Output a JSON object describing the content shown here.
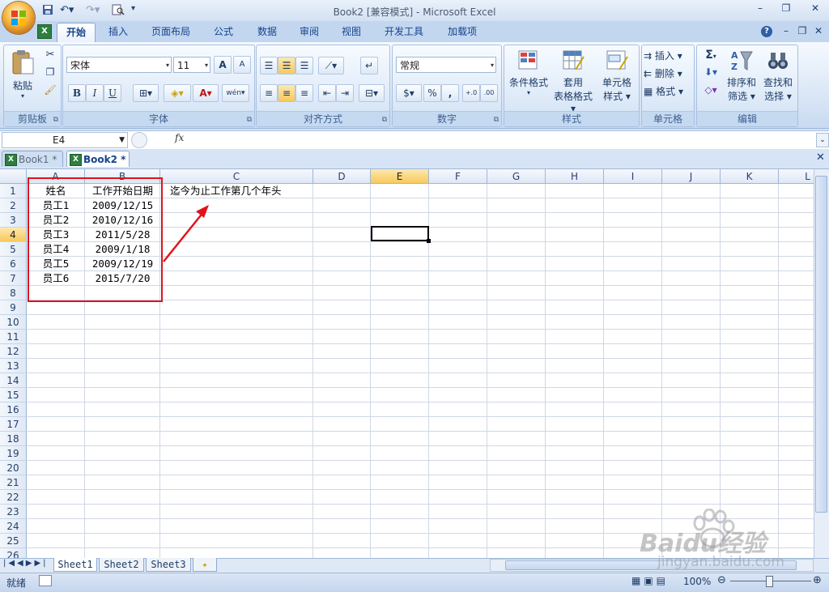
{
  "window": {
    "title": "Book2  [兼容模式] - Microsoft Excel",
    "controls": [
      "–",
      "❐",
      "✕"
    ],
    "doc_controls": [
      "?",
      "–",
      "❐",
      "✕"
    ]
  },
  "ribbon": {
    "tabs": [
      "开始",
      "插入",
      "页面布局",
      "公式",
      "数据",
      "审阅",
      "视图",
      "开发工具",
      "加载项"
    ],
    "active_tab": "开始",
    "clipboard": {
      "paste_label": "粘贴",
      "group_label": "剪贴板"
    },
    "font": {
      "name": "宋体",
      "size": "11",
      "group_label": "字体",
      "bold": "B",
      "italic": "I",
      "underline": "U",
      "grow": "A",
      "shrink": "A",
      "phonetic": "wén"
    },
    "alignment": {
      "group_label": "对齐方式"
    },
    "number": {
      "format": "常规",
      "group_label": "数字",
      "percent": "%",
      "comma": ",",
      "inc_decimal": "+.0",
      "dec_decimal": ".00"
    },
    "styles": {
      "group_label": "样式",
      "conditional": "条件格式",
      "table_format": [
        "套用",
        "表格格式"
      ],
      "cell_styles": [
        "单元格",
        "样式"
      ]
    },
    "cells": {
      "group_label": "单元格",
      "insert": "插入",
      "delete": "删除",
      "format": "格式"
    },
    "editing": {
      "group_label": "编辑",
      "sum": "Σ",
      "sort_filter": [
        "排序和",
        "筛选"
      ],
      "find_select": [
        "查找和",
        "选择"
      ]
    }
  },
  "formula_bar": {
    "name_box": "E4",
    "fx": "fx",
    "content": ""
  },
  "workbooks": [
    {
      "label": "Book1 *",
      "active": false
    },
    {
      "label": "Book2 *",
      "active": true
    }
  ],
  "grid": {
    "columns": [
      "A",
      "B",
      "C",
      "D",
      "E",
      "F",
      "G",
      "H",
      "I",
      "J",
      "K",
      "L"
    ],
    "rows": [
      "1",
      "2",
      "3",
      "4",
      "5",
      "6",
      "7",
      "8",
      "9",
      "10",
      "11",
      "12",
      "13",
      "14",
      "15",
      "16",
      "17",
      "18",
      "19",
      "20",
      "21",
      "22",
      "23",
      "24",
      "25",
      "26"
    ],
    "active_cell": "E4",
    "cells": {
      "A1": "姓名",
      "B1": "工作开始日期",
      "C1": "迄今为止工作第几个年头",
      "A2": "员工1",
      "B2": "2009/12/15",
      "A3": "员工2",
      "B3": "2010/12/16",
      "A4": "员工3",
      "B4": "2011/5/28",
      "A5": "员工4",
      "B5": "2009/1/18",
      "A6": "员工5",
      "B6": "2009/12/19",
      "A7": "员工6",
      "B7": "2015/7/20"
    },
    "annotation_color": "#e0141b"
  },
  "sheets": [
    "Sheet1",
    "Sheet2",
    "Sheet3"
  ],
  "active_sheet": "Sheet1",
  "status": {
    "mode": "就绪",
    "zoom": "100%"
  },
  "watermark": {
    "brand": "Baidu经验",
    "url": "jingyan.baidu.com"
  }
}
